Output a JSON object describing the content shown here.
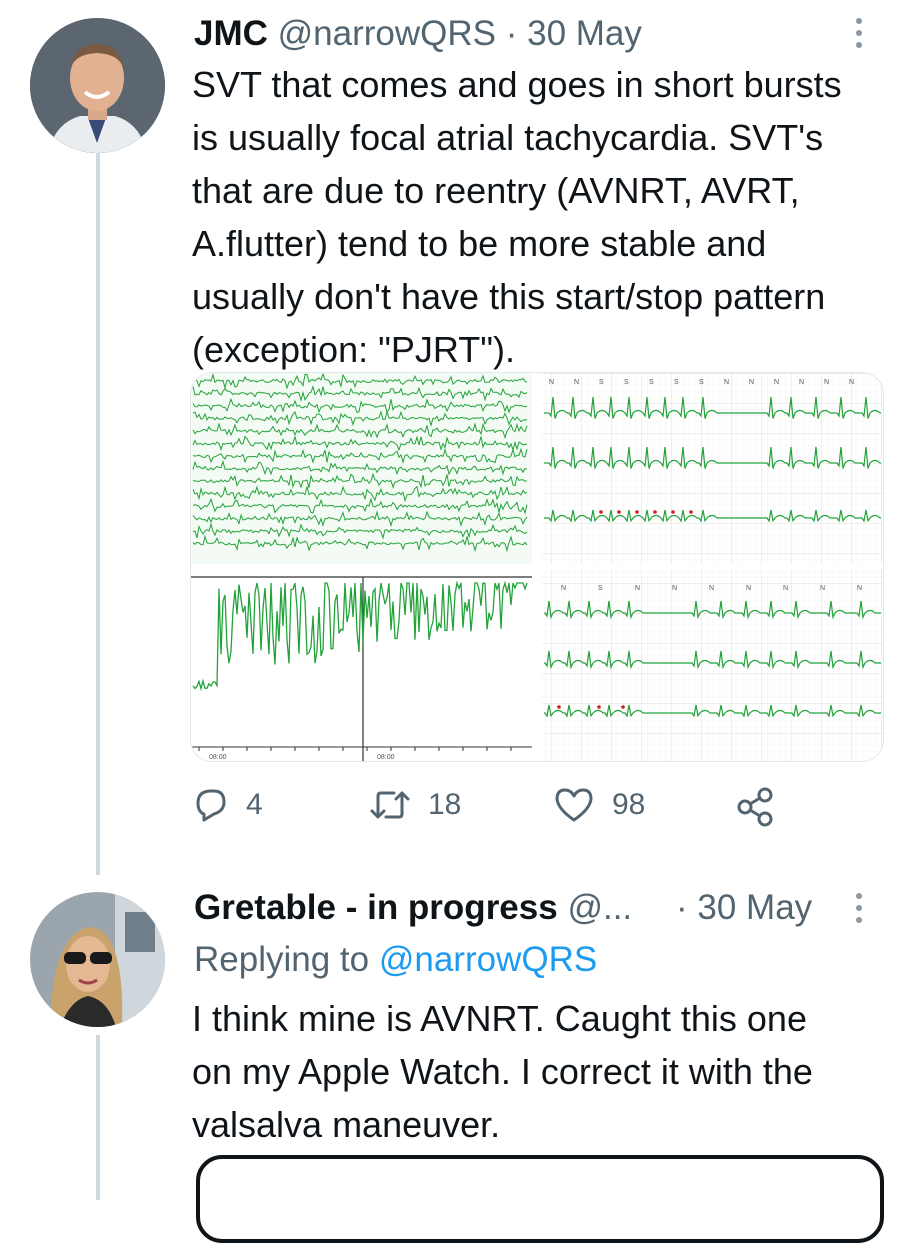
{
  "tweet1": {
    "name": "JMC",
    "handle": "@narrowQRS",
    "separator": "·",
    "date": "30 May",
    "text_lines": [
      "SVT that comes and goes in short bursts",
      "is usually focal atrial tachycardia.  SVT's",
      "that are due to reentry (AVNRT, AVRT,",
      "A.flutter) tend to be more stable and",
      "usually don't have this start/stop pattern",
      "(exception: \"PJRT\")."
    ],
    "media": {
      "panel_tr_beat_labels": [
        "N",
        "N",
        "S",
        "S",
        "S",
        "S",
        "S",
        "N",
        "N",
        "N",
        "N",
        "N",
        "N"
      ],
      "panel_br_beat_labels": [
        "N",
        "S",
        "N",
        "N",
        "N",
        "N",
        "N",
        "N",
        "N"
      ],
      "panel_bl_time_labels": [
        "08:00",
        "08:00"
      ]
    },
    "actions": {
      "reply_icon": "reply-icon",
      "reply_count": "4",
      "retweet_icon": "retweet-icon",
      "retweet_count": "18",
      "like_icon": "heart-icon",
      "like_count": "98",
      "share_icon": "share-icon"
    }
  },
  "tweet2": {
    "name": "Gretable - in progress",
    "handle": "@...",
    "separator": "·",
    "date": "30 May",
    "replying_prefix": "Replying to",
    "replying_handle": "@narrowQRS",
    "text_lines": [
      "I think mine is AVNRT.  Caught this one",
      "on my Apple Watch.  I correct it with the",
      "valsalva maneuver."
    ]
  },
  "colors": {
    "text": "#0f1419",
    "muted": "#536471",
    "link": "#1d9bf0",
    "ecg_green": "#22a33a",
    "thread_line": "#cfd9de"
  }
}
